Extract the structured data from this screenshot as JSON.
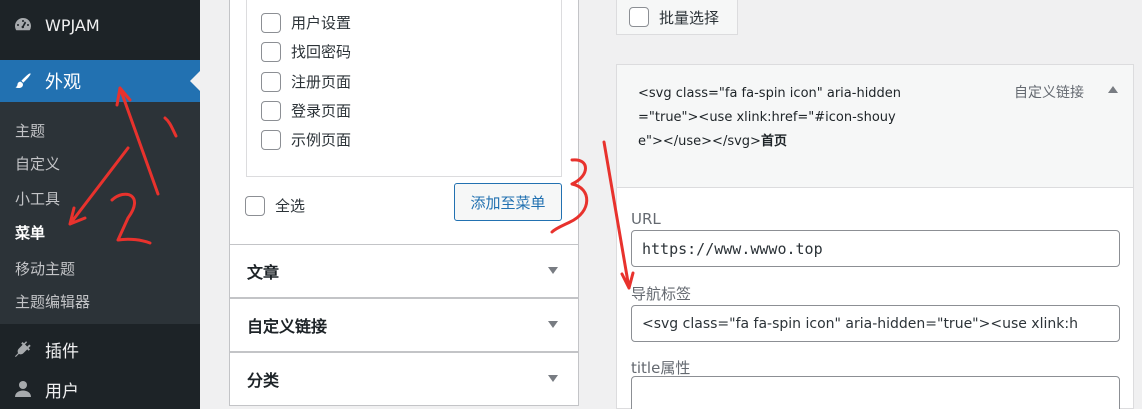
{
  "sidebar": {
    "wpjam": {
      "label": "WPJAM",
      "icon": "dashboard-icon"
    },
    "appearance": {
      "label": "外观",
      "icon": "brush-icon"
    },
    "submenu": [
      "主题",
      "自定义",
      "小工具",
      "菜单",
      "移动主题",
      "主题编辑器"
    ],
    "current_submenu": "菜单",
    "plugins": {
      "label": "插件",
      "icon": "plugin-icon"
    },
    "users": {
      "label": "用户",
      "icon": "user-icon"
    },
    "colors": {
      "bg": "#1d2327",
      "submenu_bg": "#2c3338",
      "active": "#2271b1"
    }
  },
  "pages_box": {
    "items": [
      "用户设置",
      "找回密码",
      "注册页面",
      "登录页面",
      "示例页面"
    ],
    "select_all": "全选",
    "add_button": "添加至菜单"
  },
  "accordion": {
    "posts": "文章",
    "custom_links": "自定义链接",
    "categories": "分类"
  },
  "bulk_select": "批量选择",
  "menu_item": {
    "title_code": "<svg class=\"fa fa-spin icon\" aria-hidden=\"true\"><use xlink:href=\"#icon-shouye\"></use></svg>",
    "title_text": "首页",
    "type": "自定义链接",
    "url_label": "URL",
    "url_value": "https://www.wwwo.top",
    "nav_label": "导航标签",
    "nav_value": "<svg class=\"fa fa-spin icon\" aria-hidden=\"true\"><use xlink:h",
    "title_attr_label": "title属性",
    "title_attr_value": ""
  },
  "annotations": {
    "marks": [
      "1",
      "2",
      "3"
    ],
    "color": "#e8322d"
  }
}
